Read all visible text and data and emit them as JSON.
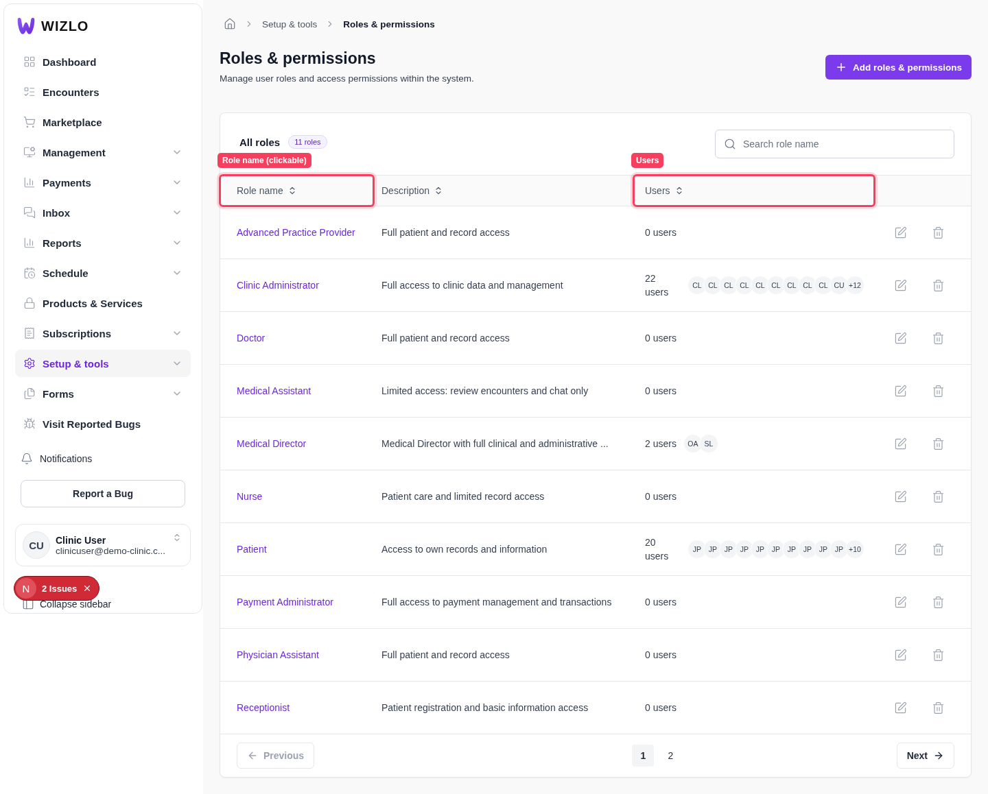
{
  "sidebar": {
    "logo": "WIZLO",
    "items": [
      {
        "label": "Dashboard",
        "expandable": false,
        "selected": false
      },
      {
        "label": "Encounters",
        "expandable": false,
        "selected": false
      },
      {
        "label": "Marketplace",
        "expandable": false,
        "selected": false
      },
      {
        "label": "Management",
        "expandable": true,
        "selected": false
      },
      {
        "label": "Payments",
        "expandable": true,
        "selected": false
      },
      {
        "label": "Inbox",
        "expandable": true,
        "selected": false
      },
      {
        "label": "Reports",
        "expandable": true,
        "selected": false
      },
      {
        "label": "Schedule",
        "expandable": true,
        "selected": false
      },
      {
        "label": "Products & Services",
        "expandable": false,
        "selected": false
      },
      {
        "label": "Subscriptions",
        "expandable": true,
        "selected": false
      },
      {
        "label": "Setup & tools",
        "expandable": true,
        "selected": true
      },
      {
        "label": "Forms",
        "expandable": true,
        "selected": false
      },
      {
        "label": "Visit Reported Bugs",
        "expandable": false,
        "selected": false
      }
    ],
    "notifications": "Notifications",
    "report_button": "Report a Bug",
    "user": {
      "initials": "CU",
      "name": "Clinic User",
      "email": "clinicuser@demo-clinic.c..."
    },
    "collapse": "Collapse sidebar",
    "issues_badge": {
      "letter": "N",
      "label": "2 Issues"
    }
  },
  "breadcrumb": [
    "Setup & tools",
    "Roles & permissions"
  ],
  "page": {
    "title": "Roles & permissions",
    "subtitle": "Manage user roles and access permissions within the system.",
    "add_button": "Add roles & permissions"
  },
  "table": {
    "title": "All roles",
    "count": "11 roles",
    "search": {
      "placeholder": "Search role name"
    },
    "columns": [
      {
        "label": "Role name",
        "annotation": "Role name (clickable)"
      },
      {
        "label": "Description"
      },
      {
        "label": "Users",
        "annotation": "Users"
      }
    ],
    "rows": [
      {
        "name": "Advanced Practice Provider",
        "description": "Full patient and record access",
        "users": "0 users"
      },
      {
        "name": "Clinic Administrator",
        "description": "Full access to clinic data and management",
        "users": "22 users",
        "avatars": [
          "CL",
          "CL",
          "CL",
          "CL",
          "CL",
          "CL",
          "CL",
          "CL",
          "CL",
          "CU"
        ],
        "more": "+12"
      },
      {
        "name": "Doctor",
        "description": "Full patient and record access",
        "users": "0 users"
      },
      {
        "name": "Medical Assistant",
        "description": "Limited access: review encounters and chat only",
        "users": "0 users"
      },
      {
        "name": "Medical Director",
        "description": "Medical Director with full clinical and administrative ...",
        "users": "2 users",
        "avatars": [
          "OA",
          "SL"
        ]
      },
      {
        "name": "Nurse",
        "description": "Patient care and limited record access",
        "users": "0 users"
      },
      {
        "name": "Patient",
        "description": "Access to own records and information",
        "users": "20 users",
        "avatars": [
          "JP",
          "JP",
          "JP",
          "JP",
          "JP",
          "JP",
          "JP",
          "JP",
          "JP",
          "JP"
        ],
        "more": "+10"
      },
      {
        "name": "Payment Administrator",
        "description": "Full access to payment management and transactions",
        "users": "0 users"
      },
      {
        "name": "Physician Assistant",
        "description": "Full patient and record access",
        "users": "0 users"
      },
      {
        "name": "Receptionist",
        "description": "Patient registration and basic information access",
        "users": "0 users"
      }
    ]
  },
  "pagination": {
    "previous": {
      "label": "Previous",
      "disabled": true
    },
    "pages": [
      {
        "label": "1",
        "selected": true
      },
      {
        "label": "2",
        "selected": false
      }
    ],
    "next": {
      "label": "Next",
      "disabled": false
    }
  }
}
